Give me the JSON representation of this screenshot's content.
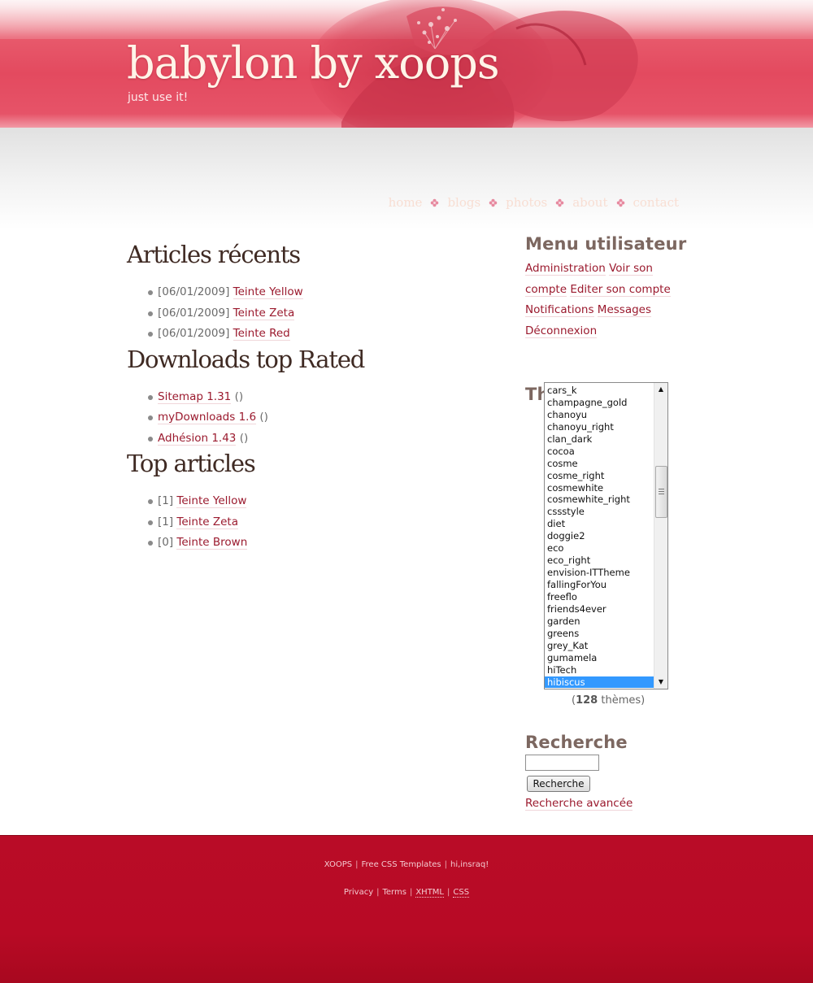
{
  "header": {
    "title": "babylon by xoops",
    "slogan": "just use it!"
  },
  "nav": {
    "items": [
      "home",
      "blogs",
      "photos",
      "about",
      "contact"
    ]
  },
  "main": {
    "recent": {
      "title": "Articles récents",
      "items": [
        {
          "date": "[06/01/2009]",
          "link": "Teinte Yellow"
        },
        {
          "date": "[06/01/2009]",
          "link": "Teinte Zeta"
        },
        {
          "date": "[06/01/2009]",
          "link": "Teinte Red"
        }
      ]
    },
    "downloads": {
      "title": "Downloads top Rated",
      "items": [
        {
          "link": "Sitemap 1.31",
          "suffix": "()"
        },
        {
          "link": "myDownloads 1.6",
          "suffix": "()"
        },
        {
          "link": "Adhésion 1.43",
          "suffix": "()"
        }
      ]
    },
    "top": {
      "title": "Top articles",
      "items": [
        {
          "count": "[1]",
          "link": "Teinte Yellow"
        },
        {
          "count": "[1]",
          "link": "Teinte Zeta"
        },
        {
          "count": "[0]",
          "link": "Teinte Brown"
        }
      ]
    }
  },
  "sidebar": {
    "user_menu": {
      "title": "Menu utilisateur",
      "links": [
        "Administration",
        "Voir son compte",
        "Editer son compte",
        "Notifications",
        "Messages",
        "Déconnexion"
      ]
    },
    "themes": {
      "title": "Themes",
      "options": [
        "cars_k",
        "champagne_gold",
        "chanoyu",
        "chanoyu_right",
        "clan_dark",
        "cocoa",
        "cosme",
        "cosme_right",
        "cosmewhite",
        "cosmewhite_right",
        "cssstyle",
        "diet",
        "doggie2",
        "eco",
        "eco_right",
        "envision-ITTheme",
        "fallingForYou",
        "freeflo",
        "friends4ever",
        "garden",
        "greens",
        "grey_Kat",
        "gumamela",
        "hiTech",
        "hibiscus"
      ],
      "selected": "hibiscus",
      "count_open": "(",
      "count": "128",
      "count_label": "thèmes)"
    },
    "search": {
      "title": "Recherche",
      "button": "Recherche",
      "input_value": "",
      "advanced": "Recherche avancée"
    }
  },
  "footer": {
    "line1": [
      "XOOPS",
      "Free CSS Templates",
      "hi,insraq!"
    ],
    "line2": [
      "Privacy",
      "Terms",
      "XHTML",
      "CSS"
    ]
  },
  "colors": {
    "header_pink": "#e34a5f",
    "link": "#9b1a2e",
    "footer_red": "#b90c27",
    "selection_blue": "#3399ff"
  }
}
